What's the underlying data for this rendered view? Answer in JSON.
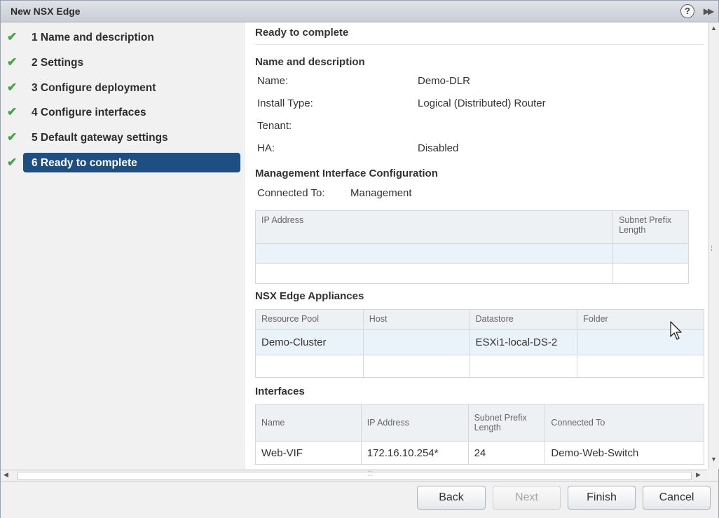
{
  "window": {
    "title": "New NSX Edge"
  },
  "steps": [
    {
      "label": "1  Name and description",
      "done": true
    },
    {
      "label": "2  Settings",
      "done": true
    },
    {
      "label": "3  Configure deployment",
      "done": true
    },
    {
      "label": "4  Configure interfaces",
      "done": true
    },
    {
      "label": "5  Default gateway settings",
      "done": true
    },
    {
      "label": "6  Ready to complete",
      "done": true,
      "active": true
    }
  ],
  "check_glyph": "✔",
  "help_glyph": "?",
  "expand_glyph": "▶▶",
  "summary": {
    "heading": "Ready to complete",
    "name_section": {
      "title": "Name and description",
      "fields": [
        {
          "label": "Name:",
          "value": "Demo-DLR"
        },
        {
          "label": "Install Type:",
          "value": "Logical (Distributed) Router"
        },
        {
          "label": "Tenant:",
          "value": ""
        },
        {
          "label": "HA:",
          "value": "Disabled"
        }
      ]
    },
    "mgmt_section": {
      "title": "Management Interface Configuration",
      "connected_label": "Connected To:",
      "connected_value": "Management",
      "columns": [
        "IP Address",
        "Subnet Prefix Length"
      ],
      "rows": [
        [
          "",
          ""
        ],
        [
          "",
          ""
        ]
      ]
    },
    "appliances_section": {
      "title": "NSX Edge Appliances",
      "columns": [
        "Resource Pool",
        "Host",
        "Datastore",
        "Folder"
      ],
      "rows": [
        [
          "Demo-Cluster",
          "",
          "ESXi1-local-DS-2",
          ""
        ],
        [
          "",
          "",
          "",
          ""
        ]
      ]
    },
    "interfaces_section": {
      "title": "Interfaces",
      "columns": [
        "Name",
        "IP Address",
        "Subnet Prefix Length",
        "Connected To"
      ],
      "rows": [
        [
          "Web-VIF",
          "172.16.10.254*",
          "24",
          "Demo-Web-Switch"
        ]
      ]
    }
  },
  "buttons": {
    "back": "Back",
    "next": "Next",
    "finish": "Finish",
    "cancel": "Cancel"
  },
  "colors": {
    "active_step": "#1d4f82",
    "check": "#3ea83a",
    "row_alt": "#eaf2fa"
  }
}
